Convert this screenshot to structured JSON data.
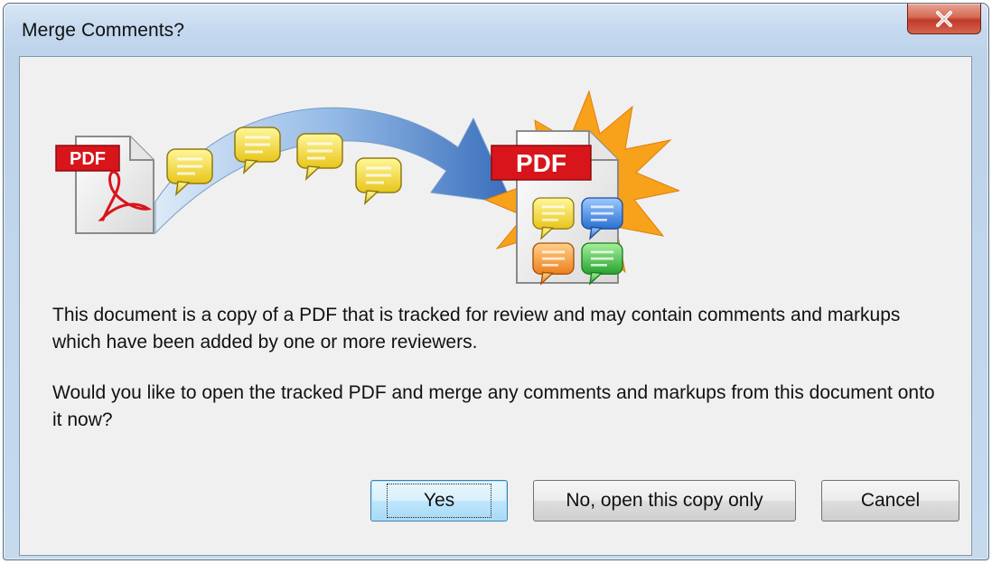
{
  "window": {
    "title": "Merge Comments?"
  },
  "illustration": {
    "source_doc_label": "PDF",
    "target_doc_label": "PDF",
    "comment_colors": [
      "#f2e24a",
      "#4a8fe0",
      "#f29a3a",
      "#3fbf4a"
    ],
    "icons": [
      "pdf-source-document-icon",
      "comment-bubble-icon",
      "merge-arrow-icon",
      "pdf-target-document-icon",
      "starburst-icon"
    ]
  },
  "message": {
    "line1": "This document is a copy of a PDF that is tracked for review and may contain comments and markups which have been added by one or more reviewers.",
    "line2": "Would you like to open the tracked PDF and merge any comments and markups from this document onto it now?"
  },
  "buttons": {
    "yes": "Yes",
    "no": "No, open this copy only",
    "cancel": "Cancel"
  }
}
